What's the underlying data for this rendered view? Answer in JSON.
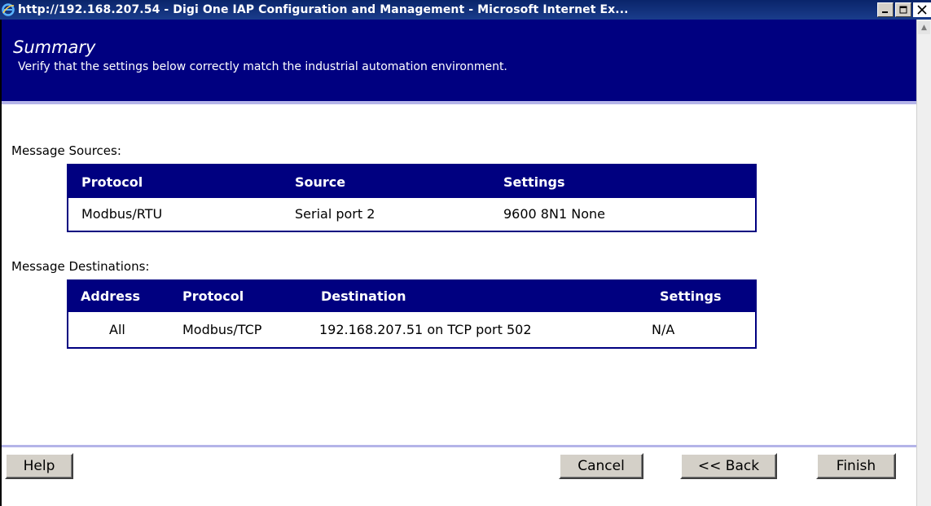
{
  "window": {
    "title": "http://192.168.207.54 - Digi One IAP Configuration and Management - Microsoft Internet Ex..."
  },
  "header": {
    "title": "Summary",
    "subtitle": "Verify that the settings below correctly match the industrial automation environment."
  },
  "sources": {
    "label": "Message Sources:",
    "columns": [
      "Protocol",
      "Source",
      "Settings"
    ],
    "rows": [
      [
        "Modbus/RTU",
        "Serial port 2",
        "9600 8N1 None"
      ]
    ]
  },
  "destinations": {
    "label": "Message Destinations:",
    "columns": [
      "Address",
      "Protocol",
      "Destination",
      "Settings"
    ],
    "rows": [
      [
        "All",
        "Modbus/TCP",
        "192.168.207.51 on TCP port 502",
        "N/A"
      ]
    ]
  },
  "buttons": {
    "help": "Help",
    "cancel": "Cancel",
    "back": "<< Back",
    "finish": "Finish"
  },
  "icons": {
    "browser": "ie-icon",
    "minimize": "minimize-icon",
    "maximize": "maximize-icon",
    "close": "close-icon",
    "scroll_up": "scroll-up-arrow-icon"
  }
}
